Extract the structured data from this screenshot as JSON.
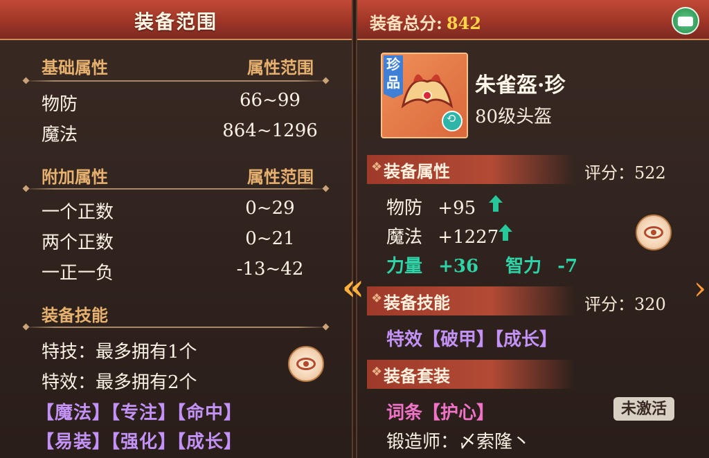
{
  "left": {
    "title": "装备范围",
    "basic": {
      "heading": "基础属性",
      "range_heading": "属性范围",
      "rows": [
        {
          "label": "物防",
          "value": "66~99"
        },
        {
          "label": "魔法",
          "value": "864~1296"
        }
      ]
    },
    "extra": {
      "heading": "附加属性",
      "range_heading": "属性范围",
      "rows": [
        {
          "label": "一个正数",
          "value": "0~29"
        },
        {
          "label": "两个正数",
          "value": "0~21"
        },
        {
          "label": "一正一负",
          "value": "-13~42"
        }
      ]
    },
    "skills": {
      "heading": "装备技能",
      "lines": [
        "特技：最多拥有1个",
        "特效：最多拥有2个"
      ],
      "tags_row1": "【魔法】【专注】【命中】",
      "tags_row2": "【易装】【强化】【成长】"
    }
  },
  "right": {
    "total_label": "装备总分:",
    "total_value": "842",
    "item": {
      "tag": "珍品",
      "name": "朱雀盔·珍",
      "sub": "80级头盔"
    },
    "equip_attr": {
      "heading": "装备属性",
      "score": "评分：522",
      "rows": [
        {
          "label": "物防",
          "value": "+95"
        },
        {
          "label": "魔法",
          "value": "+1227"
        }
      ],
      "bonus": {
        "a_label": "力量",
        "a_value": "+36",
        "b_label": "智力",
        "b_value": "-7"
      }
    },
    "equip_skill": {
      "heading": "装备技能",
      "score": "评分：320",
      "line": "特效【破甲】【成长】"
    },
    "equip_set": {
      "heading": "装备套装",
      "line": "词条【护心】",
      "status": "未激活"
    },
    "forger": "锻造师：〆索隆丶"
  },
  "colors": {
    "accent": "#9c3426",
    "gold": "#e7b16f",
    "purple": "#c392f7",
    "green": "#2fd3a8",
    "score": "#ffd44a"
  },
  "icons": [
    "eye-icon",
    "green-chest-icon",
    "refresh-icon",
    "up-arrow-icon",
    "chevron-left-icon",
    "chevron-right-icon"
  ]
}
